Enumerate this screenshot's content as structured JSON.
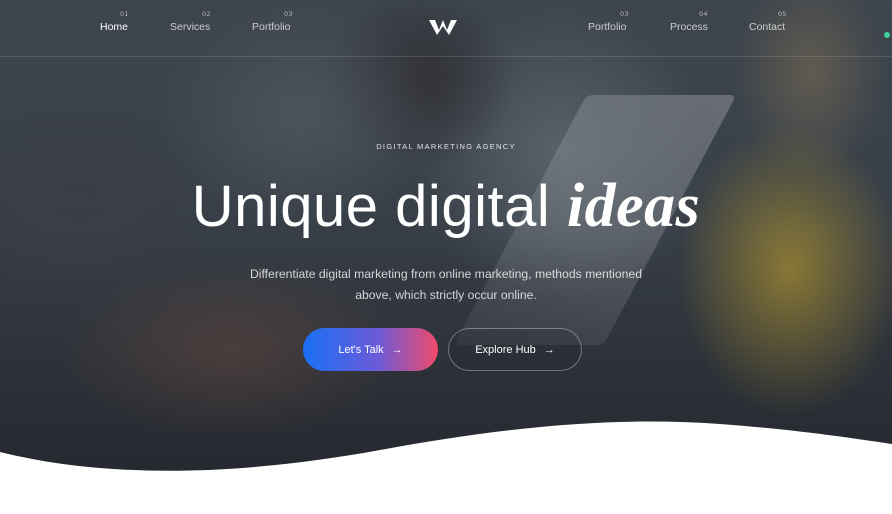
{
  "nav": {
    "left_items": [
      {
        "num": "01",
        "label": "Home"
      },
      {
        "num": "02",
        "label": "Services"
      },
      {
        "num": "03",
        "label": "Portfolio"
      }
    ],
    "right_items": [
      {
        "num": "03",
        "label": "Portfolio"
      },
      {
        "num": "04",
        "label": "Process"
      },
      {
        "num": "05",
        "label": "Contact"
      }
    ],
    "active": "Home",
    "logo_icon": "w-logo-icon"
  },
  "hero": {
    "tagline": "DIGITAL MARKETING AGENCY",
    "headline_plain": "Unique digital ",
    "headline_emphasis": "ideas",
    "subtitle": "Differentiate digital marketing from online marketing, methods mentioned above, which strictly occur online.",
    "primary_button": {
      "label": "Let's Talk",
      "icon": "arrow-right-icon"
    },
    "secondary_button": {
      "label": "Explore Hub",
      "icon": "arrow-right-icon"
    }
  },
  "colors": {
    "button_gradient_start": "#1a6ff5",
    "button_gradient_end": "#f04a6a",
    "background": "#ffffff"
  }
}
